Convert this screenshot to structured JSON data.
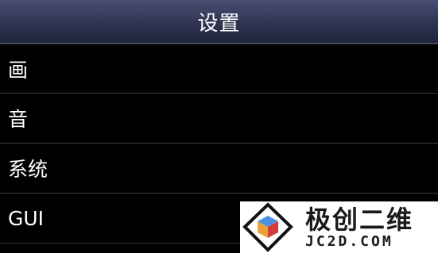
{
  "header": {
    "title": "设置"
  },
  "menu": {
    "items": [
      {
        "label": "画"
      },
      {
        "label": "音"
      },
      {
        "label": "系统"
      },
      {
        "label": "GUI"
      }
    ]
  },
  "watermark": {
    "brand_cn": "极创二维",
    "brand_url": "JC2D.COM"
  }
}
